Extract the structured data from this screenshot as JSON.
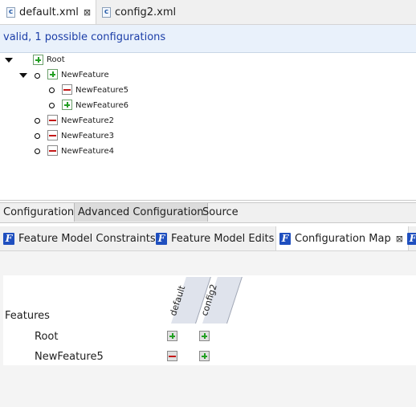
{
  "editor_tabs": [
    {
      "label": "default.xml",
      "active": true,
      "icon": "xml-file-icon",
      "closable": true
    },
    {
      "label": "config2.xml",
      "active": false,
      "icon": "xml-file-icon",
      "closable": false
    }
  ],
  "status": {
    "text": "valid, 1 possible configurations"
  },
  "tree": {
    "items": [
      {
        "label": "Root",
        "state": "selected"
      },
      {
        "label": "NewFeature",
        "state": "selected"
      },
      {
        "label": "NewFeature5",
        "state": "deselected"
      },
      {
        "label": "NewFeature6",
        "state": "selected"
      },
      {
        "label": "NewFeature2",
        "state": "deselected"
      },
      {
        "label": "NewFeature3",
        "state": "deselected"
      },
      {
        "label": "NewFeature4",
        "state": "deselected"
      }
    ]
  },
  "page_tabs": [
    {
      "label": "Configuration",
      "active": false
    },
    {
      "label": "Advanced Configuration",
      "active": true
    },
    {
      "label": "Source",
      "active": false
    }
  ],
  "view_tabs": [
    {
      "label": "Feature Model Constraints",
      "icon": "feature-model-icon",
      "active": false
    },
    {
      "label": "Feature Model Edits",
      "icon": "feature-model-icon",
      "active": false
    },
    {
      "label": "Configuration Map",
      "icon": "feature-model-icon",
      "active": true,
      "closable": true
    }
  ],
  "config_map": {
    "features_label": "Features",
    "columns": [
      "default",
      "config2"
    ],
    "rows": [
      {
        "feature": "Root",
        "values": [
          "selected",
          "selected"
        ]
      },
      {
        "feature": "NewFeature5",
        "values": [
          "deselected",
          "selected"
        ]
      }
    ]
  },
  "colors": {
    "status_text": "#1c3ea8",
    "selected_green": "#23a023",
    "deselected_red": "#c41818",
    "view_icon_blue": "#1f4fbf"
  }
}
